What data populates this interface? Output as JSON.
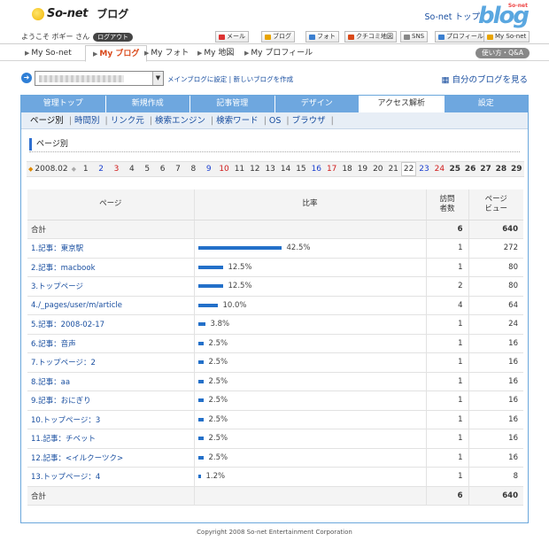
{
  "header": {
    "brand": "So-net",
    "product": "ブログ",
    "top_link": "So-net トップ",
    "blog_logo": "blog",
    "blog_logo_small": "So-net"
  },
  "userbar": {
    "welcome": "ようこそ ボギー さん",
    "logout": "ログアウト",
    "services": [
      "メール",
      "ブログ",
      "フォト",
      "クチコミ地図",
      "SNS",
      "プロフィール",
      "My So-net"
    ]
  },
  "nav": {
    "items": [
      "My So-net",
      "My ブログ",
      "My フォト",
      "My 地図",
      "My プロフィール"
    ],
    "active_index": 1,
    "help": "使い方・Q&A"
  },
  "blog_select": {
    "main_blog_link": "メインブログに設定",
    "new_blog_link": "新しいブログを作成",
    "view_own_blog": "自分のブログを見る"
  },
  "tabs": [
    "管理トップ",
    "新規作成",
    "記事管理",
    "デザイン",
    "アクセス解析",
    "設定"
  ],
  "active_tab": 4,
  "subtabs": [
    "ページ別",
    "時間別",
    "リンク元",
    "検索エンジン",
    "検索ワード",
    "OS",
    "ブラウザ"
  ],
  "section_title": "ページ別",
  "date_nav": {
    "month": "2008.02",
    "days": [
      "1",
      "2",
      "3",
      "4",
      "5",
      "6",
      "7",
      "8",
      "9",
      "10",
      "11",
      "12",
      "13",
      "14",
      "15",
      "16",
      "17",
      "18",
      "19",
      "20",
      "21",
      "22",
      "23",
      "24",
      "25",
      "26",
      "27",
      "28",
      "29"
    ],
    "sat_days": [
      "2",
      "9",
      "16",
      "23"
    ],
    "sun_days": [
      "3",
      "10",
      "17",
      "24"
    ],
    "selected_day": "22",
    "bold_days": [
      "25",
      "26",
      "27",
      "28",
      "29"
    ]
  },
  "table": {
    "headers": {
      "page": "ページ",
      "ratio": "比率",
      "visits": "訪問\n者数",
      "views": "ページ\nビュー"
    },
    "total_label": "合計",
    "total_visits": "6",
    "total_views": "640",
    "rows": [
      {
        "page": "1.記事：東京駅",
        "ratio": 42.5,
        "ratio_text": "42.5%",
        "visits": "1",
        "views": "272"
      },
      {
        "page": "2.記事：macbook",
        "ratio": 12.5,
        "ratio_text": "12.5%",
        "visits": "1",
        "views": "80"
      },
      {
        "page": "3.トップページ",
        "ratio": 12.5,
        "ratio_text": "12.5%",
        "visits": "2",
        "views": "80"
      },
      {
        "page": "4./_pages/user/m/article",
        "ratio": 10.0,
        "ratio_text": "10.0%",
        "visits": "4",
        "views": "64"
      },
      {
        "page": "5.記事：2008-02-17",
        "ratio": 3.8,
        "ratio_text": "3.8%",
        "visits": "1",
        "views": "24"
      },
      {
        "page": "6.記事：音声",
        "ratio": 2.5,
        "ratio_text": "2.5%",
        "visits": "1",
        "views": "16"
      },
      {
        "page": "7.トップページ：2",
        "ratio": 2.5,
        "ratio_text": "2.5%",
        "visits": "1",
        "views": "16"
      },
      {
        "page": "8.記事：aa",
        "ratio": 2.5,
        "ratio_text": "2.5%",
        "visits": "1",
        "views": "16"
      },
      {
        "page": "9.記事：おにぎり",
        "ratio": 2.5,
        "ratio_text": "2.5%",
        "visits": "1",
        "views": "16"
      },
      {
        "page": "10.トップページ：3",
        "ratio": 2.5,
        "ratio_text": "2.5%",
        "visits": "1",
        "views": "16"
      },
      {
        "page": "11.記事：チベット",
        "ratio": 2.5,
        "ratio_text": "2.5%",
        "visits": "1",
        "views": "16"
      },
      {
        "page": "12.記事：<イルクーツク>",
        "ratio": 2.5,
        "ratio_text": "2.5%",
        "visits": "1",
        "views": "16"
      },
      {
        "page": "13.トップページ：4",
        "ratio": 1.2,
        "ratio_text": "1.2%",
        "visits": "1",
        "views": "8"
      }
    ]
  },
  "footer": "Copyright 2008 So-net Entertainment Corporation",
  "colors": {
    "tab_bg": "#6ea7df",
    "bar": "#2370c9",
    "link": "#1a4fa0",
    "accent_orange": "#d9491a"
  }
}
